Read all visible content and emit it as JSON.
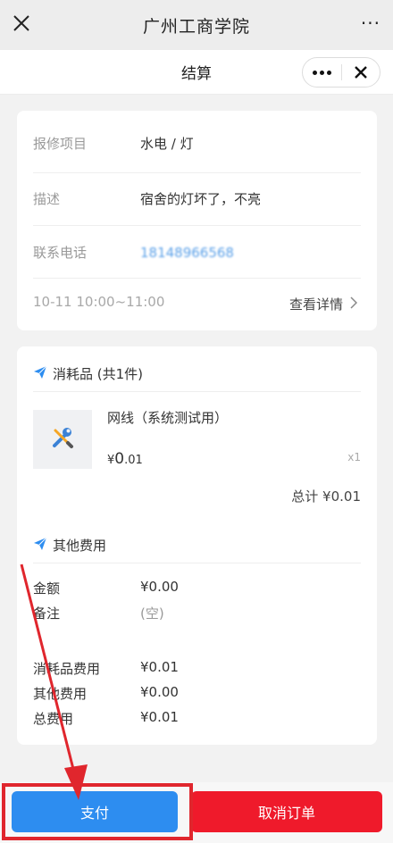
{
  "topbar": {
    "title": "广州工商学院",
    "more": "···"
  },
  "subbar": {
    "title": "结算"
  },
  "order": {
    "rows": [
      {
        "label": "报修项目",
        "value": "水电 / 灯"
      },
      {
        "label": "描述",
        "value": "宿舍的灯坏了，不亮"
      },
      {
        "label": "联系电话",
        "value": "18148966568"
      }
    ],
    "time": "10-11  10:00~11:00",
    "detail_label": "查看详情"
  },
  "consumables": {
    "title": "消耗品 (共1件)",
    "item": {
      "name": "网线（系统测试用）",
      "price_symbol": "¥",
      "price_int": "0",
      "price_dec": ".01",
      "qty": "x1"
    },
    "total": "总计 ¥0.01"
  },
  "other": {
    "title": "其他费用",
    "amount_label": "金额",
    "amount_value": "¥0.00",
    "note_label": "备注",
    "note_value": "(空)"
  },
  "summary": [
    {
      "label": "消耗品费用",
      "value": "¥0.01"
    },
    {
      "label": "其他费用",
      "value": "¥0.00"
    },
    {
      "label": "总费用",
      "value": "¥0.01"
    }
  ],
  "actions": {
    "pay": "支付",
    "cancel": "取消订单"
  },
  "colors": {
    "pay": "#2d8df0",
    "cancel": "#ef1a2b",
    "icon_blue": "#2d8df0",
    "annotation": "#e0262d"
  }
}
